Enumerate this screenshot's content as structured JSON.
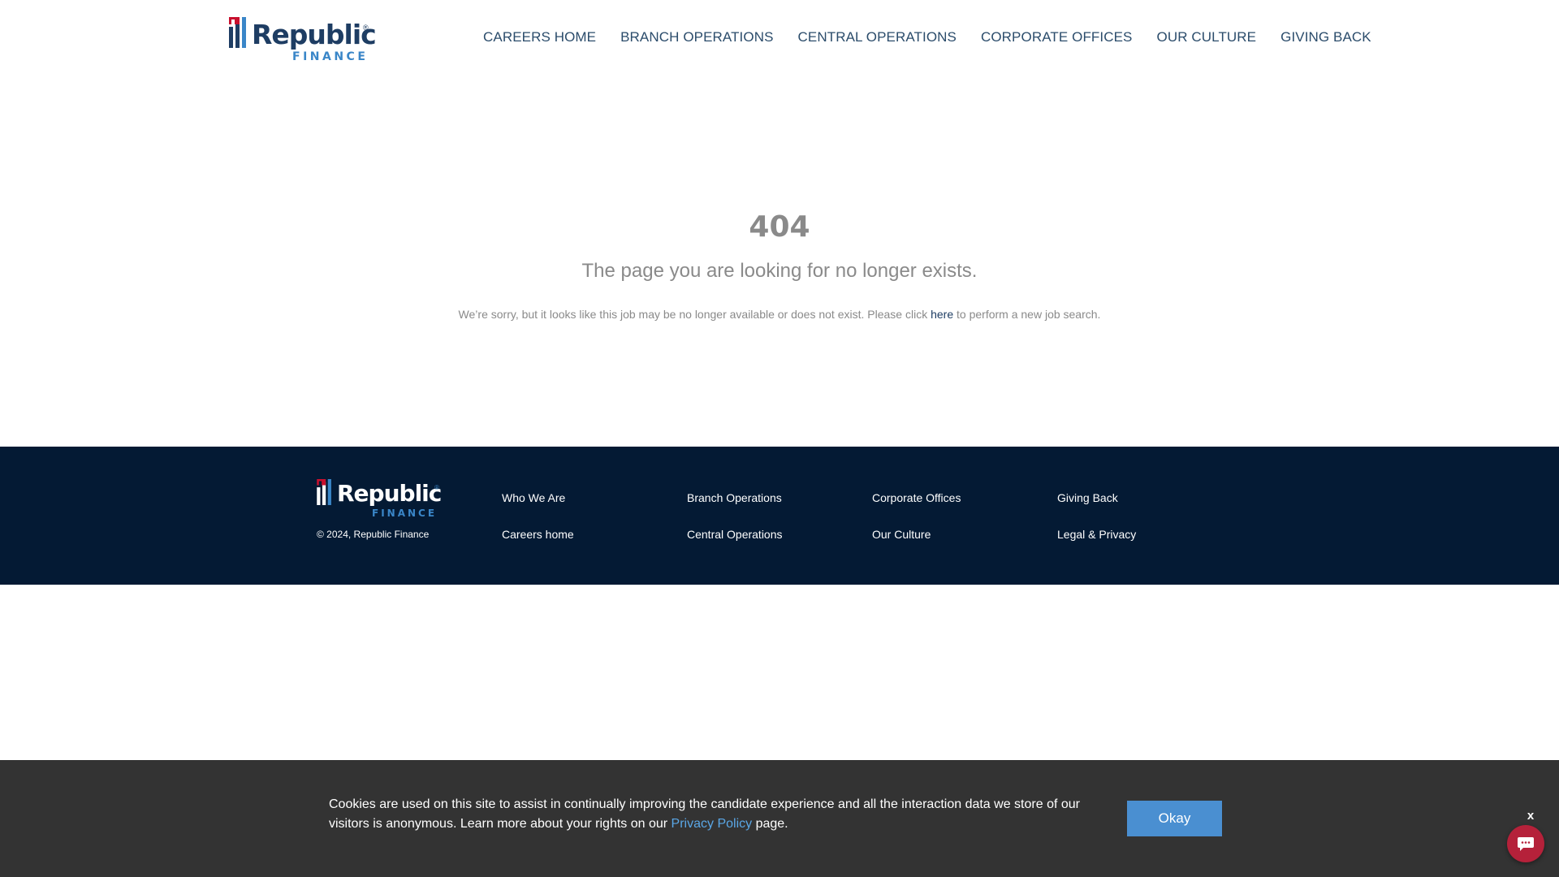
{
  "header": {
    "logo": {
      "word": "Republic",
      "sub": "FINANCE",
      "reg": "®"
    },
    "nav": [
      "CAREERS HOME",
      "BRANCH OPERATIONS",
      "CENTRAL OPERATIONS",
      "CORPORATE OFFICES",
      "OUR CULTURE",
      "GIVING BACK"
    ]
  },
  "error": {
    "code": "404",
    "title": "The page you are looking for no longer exists.",
    "message_before": "We’re sorry, but it looks like this job may be no longer available or does not exist. Please click ",
    "link": "here",
    "message_after": " to perform a new job search."
  },
  "footer": {
    "logo": {
      "word": "Republic",
      "sub": "FINANCE",
      "reg": "®"
    },
    "copyright": "© 2024, Republic Finance",
    "links": [
      "Who We Are",
      "Branch Operations",
      "Corporate Offices",
      "Giving Back",
      "Careers home",
      "Central Operations",
      "Our Culture",
      "Legal & Privacy"
    ]
  },
  "cookie": {
    "text_before": "Cookies are used on this site to assist in continually improving the candidate experience and all the interaction data we store of our visitors is anonymous. Learn more about your rights on our ",
    "link": "Privacy Policy",
    "text_after": " page.",
    "button": "Okay",
    "close": "x"
  },
  "colors": {
    "nav_text": "#2b4c6b",
    "logo_navy": "#1e3d63",
    "logo_blue": "#3a86c8",
    "logo_red": "#c8102e",
    "footer_bg": "#041a34",
    "cookie_bg": "#333333",
    "okay_button": "#4a8fd1",
    "chat_button": "#b5213a"
  },
  "icons": {
    "chat": "chat-bubble-icon",
    "close": "close-icon"
  }
}
